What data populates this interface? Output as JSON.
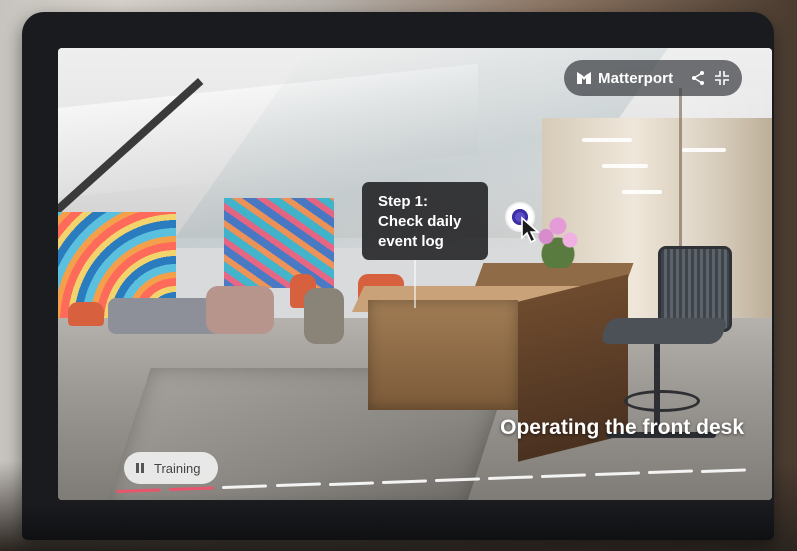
{
  "brand": {
    "name": "Matterport",
    "share_icon": "share-icon",
    "collapse_icon": "collapse-icon"
  },
  "tooltip": {
    "lines": [
      "Step 1:",
      "Check daily",
      "event log"
    ]
  },
  "hotspot": {
    "icon": "hotspot-marker-icon",
    "cursor_icon": "cursor-pointer-icon"
  },
  "caption": {
    "text": "Operating the front desk"
  },
  "training": {
    "label": "Training",
    "icon": "pause-icon"
  },
  "progress": {
    "total_segments": 12,
    "completed_segments": 2
  },
  "colors": {
    "progress_done": "#e8566e",
    "progress_remaining": "#f3f3f3",
    "hotspot": "#5b4cc8"
  }
}
